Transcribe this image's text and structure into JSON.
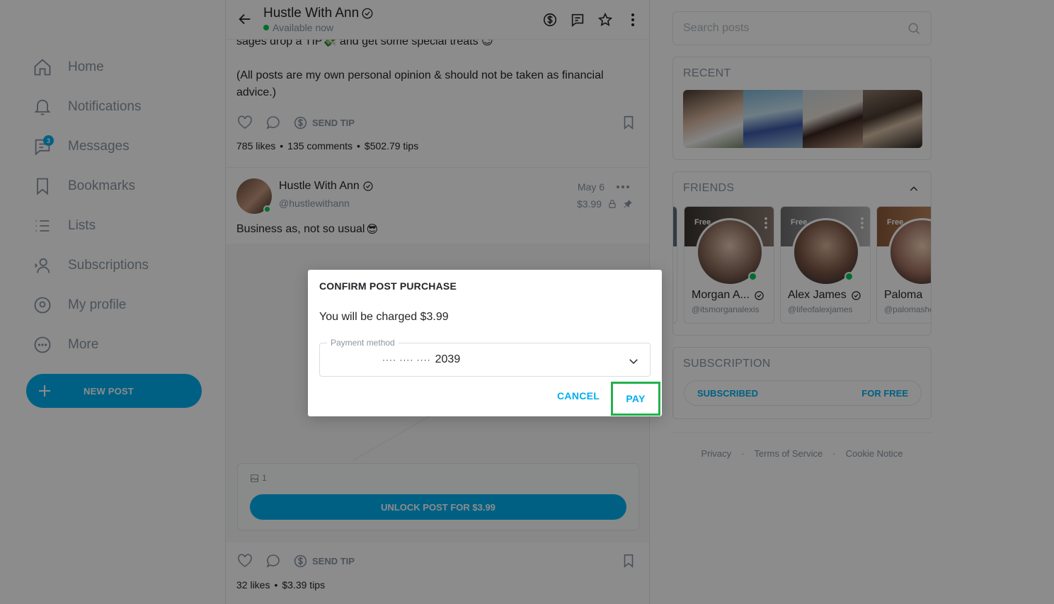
{
  "sidebar": {
    "items": [
      {
        "label": "Home",
        "icon": "home-icon"
      },
      {
        "label": "Notifications",
        "icon": "bell-icon"
      },
      {
        "label": "Messages",
        "icon": "chat-icon",
        "badge": "3"
      },
      {
        "label": "Bookmarks",
        "icon": "bookmark-icon"
      },
      {
        "label": "Lists",
        "icon": "list-icon"
      },
      {
        "label": "Subscriptions",
        "icon": "subscriptions-icon"
      },
      {
        "label": "My profile",
        "icon": "profile-icon"
      },
      {
        "label": "More",
        "icon": "more-icon"
      }
    ],
    "new_post_label": "NEW POST"
  },
  "header": {
    "creator_name": "Hustle With Ann",
    "status": "Available now"
  },
  "previous_post": {
    "text_cut": "sages drop a TIP💸 and get some special treats 😉",
    "text": "(All posts are my own personal opinion & should not be taken as financial advice.)",
    "send_tip_label": "SEND TIP",
    "likes": "785 likes",
    "comments": "135 comments",
    "tips": "$502.79 tips"
  },
  "post": {
    "author": "Hustle With Ann",
    "handle": "@hustlewithann",
    "date": "May 6",
    "price": "$3.99",
    "text": "Business as, not so usual",
    "emoji": "😎",
    "media_count": "1",
    "unlock_label": "UNLOCK POST FOR $3.99",
    "send_tip_label": "SEND TIP",
    "likes": "32 likes",
    "tips": "$3.39 tips"
  },
  "right": {
    "search_placeholder": "Search posts",
    "recent_title": "RECENT",
    "friends_title": "FRIENDS",
    "friends": [
      {
        "name": "Morgan A...",
        "handle": "@itsmorganalexis",
        "free": "Free"
      },
      {
        "name": "Alex James",
        "handle": "@lifeofalexjames",
        "free": "Free"
      },
      {
        "name": "Paloma",
        "handle": "@palomashe",
        "free": "Free"
      }
    ],
    "subscription_title": "SUBSCRIPTION",
    "subscribed_label": "SUBSCRIBED",
    "for_free_label": "FOR FREE",
    "footer": [
      "Privacy",
      "Terms of Service",
      "Cookie Notice"
    ]
  },
  "dialog": {
    "title": "CONFIRM POST PURCHASE",
    "message": "You will be charged $3.99",
    "payment_label": "Payment method",
    "card_mask": "···· ···· ····",
    "card_last4": "2039",
    "cancel_label": "CANCEL",
    "pay_label": "PAY"
  },
  "colors": {
    "accent": "#00aff0",
    "online": "#00c851",
    "highlight": "#22b14c"
  }
}
